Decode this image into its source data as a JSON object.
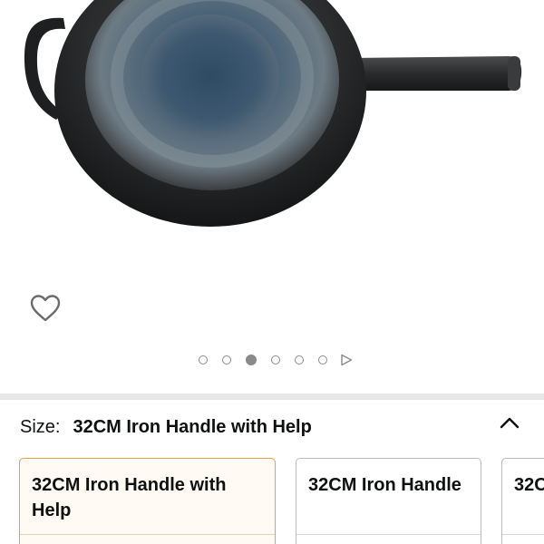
{
  "product": {
    "image_alt": "Carbon steel wok with iron handle and helper handle",
    "carousel": {
      "total_dots": 6,
      "active_index": 2
    }
  },
  "icons": {
    "wishlist": "heart-outline-icon",
    "carousel_next": "play-triangle-icon",
    "collapse": "chevron-up-icon"
  },
  "size_section": {
    "label": "Size:",
    "selected_value": "32CM Iron Handle with Help",
    "options": [
      {
        "label": "32CM Iron Handle with Help",
        "selected": true
      },
      {
        "label": "32CM Iron Handle",
        "selected": false
      },
      {
        "label": "32C",
        "selected": false
      }
    ]
  },
  "colors": {
    "selected_border": "#e3a14a",
    "selected_bg": "#fffaf4",
    "divider": "#e7e7e7",
    "text": "#0f1111"
  }
}
